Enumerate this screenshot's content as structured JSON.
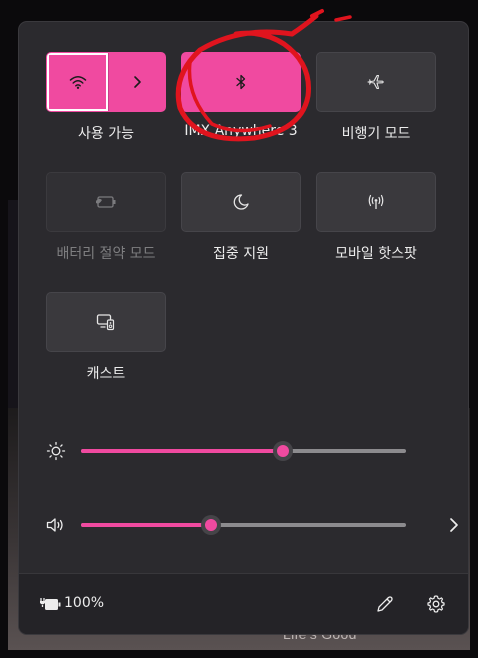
{
  "background": {
    "footer_text": "Life's Good"
  },
  "tiles": {
    "wifi": {
      "label": "사용 가능",
      "icon": "wifi-icon",
      "state": "on"
    },
    "bluetooth": {
      "label": "IMX Anywhere 3",
      "icon": "bluetooth-icon",
      "state": "on"
    },
    "airplane": {
      "label": "비행기 모드",
      "icon": "airplane-icon",
      "state": "off"
    },
    "battery_saver": {
      "label": "배터리 절약 모드",
      "icon": "battery-saver-icon",
      "state": "disabled"
    },
    "focus": {
      "label": "집중 지원",
      "icon": "moon-icon",
      "state": "off"
    },
    "hotspot": {
      "label": "모바일 핫스팟",
      "icon": "hotspot-icon",
      "state": "off"
    },
    "cast": {
      "label": "캐스트",
      "icon": "cast-icon",
      "state": "off"
    }
  },
  "sliders": {
    "brightness": {
      "icon": "brightness-icon",
      "value_percent": 62
    },
    "volume": {
      "icon": "speaker-icon",
      "value_percent": 40
    }
  },
  "footer": {
    "battery_text": "100%",
    "battery_icon": "battery-charging-icon"
  },
  "colors": {
    "accent": "#f04aa0",
    "panel": "#2b2a2e",
    "annotation": "#e0141e"
  }
}
